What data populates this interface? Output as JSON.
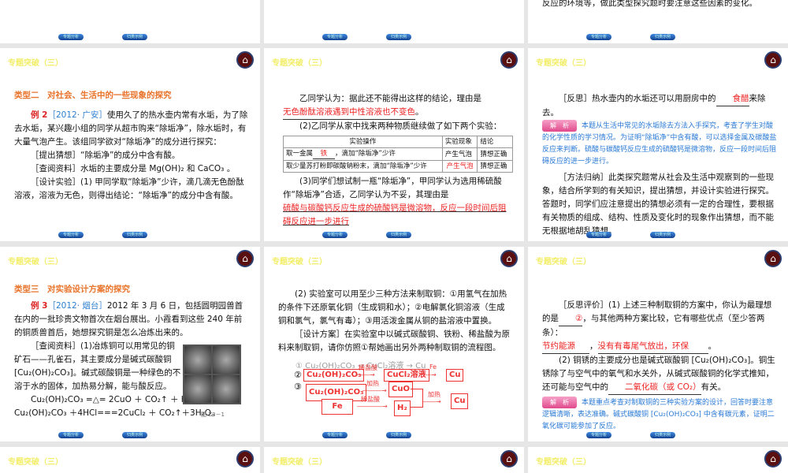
{
  "header": "专题突破（三）",
  "nav": {
    "prev": "专题分析",
    "next": "归类示例"
  },
  "top_right_text": "反应的环境等，做此类型探究题时要注意这些因素的变化。",
  "s1": {
    "type": "类型二　对社会、生活中的一些现象的探究",
    "ex": "例 2",
    "src": "［2012· 广安］",
    "p1": "使用久了的热水壶内常有水垢，为了除去水垢，某兴趣小组的同学从超市购来“除垢净”，除水垢时，有大量气泡产生。该组同学欲对“除垢净”的成分进行探究：",
    "p2": "［提出猜想］“除垢净”的成分中含有酸。",
    "p3": "［查阅资料］水垢的主要成分是 Mg(OH)₂ 和 CaCO₃ 。",
    "p4": "［设计实验］(1) 甲同学取“除垢净”少许，滴几滴无色酚酞溶液，溶液为无色，则得出结论：“除垢净”的成分中含有酸。"
  },
  "s2": {
    "p1": "乙同学认为：据此还不能得出这样的结论，理由是",
    "a1": "无色酚酞溶液遇到中性溶液也不变色",
    "p2": "(2)乙同学从家中找来两种物质继续做了如下两个实验：",
    "th": [
      "实验操作",
      "实验现象",
      "结论"
    ],
    "r1": [
      "取一金属",
      "铁",
      "，滴加“除垢净”少许",
      "产生气泡",
      "猜想正确"
    ],
    "r2": [
      "取少量苏打粉即碳酸钠粉末，滴加“除垢净”少许",
      "产生气泡",
      "猜想正确"
    ],
    "p3": "(3)同学们想试制一瓶“除垢净”，甲同学认为选用稀硫酸作“除垢净”合适，乙同学认为不妥，其理由是",
    "a3": "硫酸与碳酸钙反应生成的硫酸钙是微溶物，反应一段时间后阻碍反应进一步进行"
  },
  "s3": {
    "p1": "［反思］热水壶内的水垢还可以用厨房中的",
    "a1": "食醋",
    "p1b": "来除去。",
    "tag": "解　析",
    "an": "本题从生活中常见的水垢除去方法入手探究，考查了学生对酸的化学性质的学习情况。为证明“除垢净”中含有酸，可以选择金属及碳酸盐反应来判断。硫酸与碳酸钙反应生成的硫酸钙是微溶物，反应一段时间后阻碍反应的进一步进行。",
    "p2": "［方法归纳］此类探究题常从社会及生活中观察到的一些现象，结合所学到的有关知识，提出猜想，并设计实验进行探究。答题时，同学们应注意提出的猜想必须有一定的合理性，要根据有关物质的组成、结构、性质及变化时的现象作出猜想，而不能无根据地胡乱猜想。"
  },
  "s4": {
    "type": "类型三　对实验设计方案的探究",
    "ex": "例 3",
    "src": "［2012· 烟台］",
    "p1": "2012 年 3 月 6 日，包括圆明园兽首在内的一批珍贵文物首次在烟台展出。小霞看到这些 240 年前的铜质兽首后，她想探究铜是怎么冶炼出来的。",
    "p2": "［查阅资料］(1)冶炼铜可以用常见的铜矿石——孔雀石，其主要成分是碱式碳酸铜[Cu₂(OH)₂CO₃]。碱式碳酸铜是一种绿色的不溶于水的固体，加热易分解，能与酸反应。",
    "p3": "Cu₂(OH)₂CO₃ =△= 2CuO ＋ CO₂↑ ＋ H₂O， Cu₂(OH)₂CO₃ ＋4HCl===2CuCl₂ ＋ CO₂↑＋3H₂O。",
    "cap": "图 Z3－1"
  },
  "s5": {
    "p1": "(2) 实验室可以用至少三种方法来制取铜：①用氢气在加热的条件下还原氧化铜（生成铜和水）；②电解氯化铜溶液（生成铜和氯气，氯气有毒）；③用活泼金属从铜的盐溶液中置换。",
    "p2": "［设计方案］在实验室中以碱式碳酸铜、铁粉、稀盐酸为原料来制取铜，请你仿照①帮她画出另外两种制取铜的流程图。",
    "f1": "① Cu₂(OH)₂CO₃ → CuCl₂溶液 → Cu",
    "n2": "②",
    "n3": "③",
    "malachite": "Cu₂(OH)₂CO₃",
    "hcl": "稀盐酸",
    "cucl2": "CuCl₂溶液",
    "fe_label": "Fe",
    "cu": "Cu",
    "heat": "加热",
    "cuo": "CuO",
    "fe": "Fe",
    "h2": "H₂"
  },
  "s6": {
    "p1": "［反思评价］(1) 上述三种制取铜的方案中，你认为最理想的是",
    "a1": "②",
    "p1b": "，与其他两种方案比较，它有哪些优点（至少答两条）：",
    "a2": "节约能源",
    "a3": "没有有毒尾气放出，环保",
    "p2": "(2) 铜锈的主要成分也是碱式碳酸铜 [Cu₂(OH)₂CO₃]。铜生锈除了与空气中的氧气和水关外，从碱式碳酸铜的化学式推知，还可能与空气中的",
    "a4": "二氧化碳（或 CO₂）",
    "p2b": "有关。",
    "tag": "解　析",
    "an": "本题重点考查对制取铜的三种实验方案的设计，回答时要注意逻辑清晰，表达准确。碱式碳酸铜 [Cu₂(OH)₂CO₃] 中含有碳元素，证明二氧化碳可能参加了反应。"
  }
}
